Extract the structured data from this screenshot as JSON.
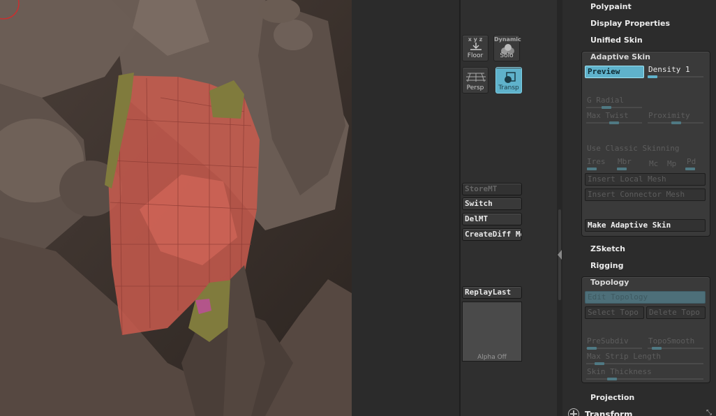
{
  "shelf": {
    "floor": {
      "label": "Floor"
    },
    "solo": {
      "top_label": "Dynamic",
      "label": "Solo"
    },
    "persp": {
      "label": "Persp"
    },
    "transp": {
      "label": "Transp"
    },
    "buttons": [
      "StoreMT",
      "Switch",
      "DelMT",
      "CreateDiff Me",
      "ReplayLast"
    ],
    "alpha_label": "Alpha  Off"
  },
  "tool_palette": {
    "menus_top": [
      "Polypaint",
      "Display Properties",
      "Unified Skin"
    ],
    "adaptive_skin": {
      "title": "Adaptive Skin",
      "preview": "Preview",
      "density": "Density 1",
      "g_radial": "G Radial",
      "max_twist": "Max Twist",
      "proximity": "Proximity",
      "use_classic": "Use Classic Skinning",
      "ires": "Ires",
      "mbr": "Mbr",
      "mc": "Mc",
      "mp": "Mp",
      "pd": "Pd",
      "insert_local": "Insert Local Mesh",
      "insert_connector": "Insert Connector Mesh",
      "make_adaptive": "Make Adaptive Skin"
    },
    "menus_mid": [
      "ZSketch",
      "Rigging"
    ],
    "topology": {
      "title": "Topology",
      "edit_topology": "Edit Topology",
      "select_topo": "Select Topo",
      "delete_topo": "Delete Topo",
      "presubdiv": "PreSubdiv",
      "toposmooth": "TopoSmooth",
      "max_strip": "Max Strip Length",
      "skin_thickness": "Skin Thickness"
    },
    "menus_bottom": [
      "Projection",
      "Transform"
    ]
  },
  "colors": {
    "accent": "#5fb2cb",
    "viewport_bg": "#3a2f29",
    "mesh_red": "#c85a4e",
    "mesh_yellow": "#7f7a3d"
  }
}
